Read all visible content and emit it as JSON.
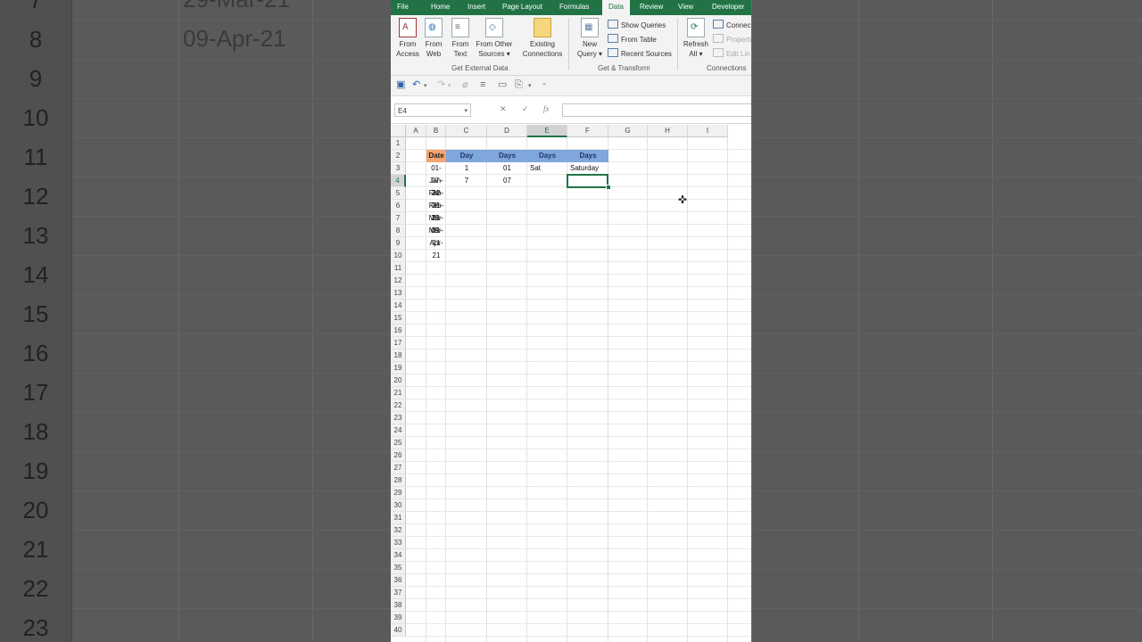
{
  "ribbon": {
    "tabs": [
      "File",
      "Home",
      "Insert",
      "Page Layout",
      "Formulas",
      "Data",
      "Review",
      "View",
      "Developer"
    ],
    "active_tab": "Data",
    "get_external_data": {
      "label": "Get External Data",
      "buttons": [
        {
          "line1": "From",
          "line2": "Access"
        },
        {
          "line1": "From",
          "line2": "Web"
        },
        {
          "line1": "From",
          "line2": "Text"
        },
        {
          "line1": "From Other",
          "line2": "Sources ▾"
        },
        {
          "line1": "Existing",
          "line2": "Connections"
        }
      ]
    },
    "get_transform": {
      "label": "Get & Transform",
      "new_query": {
        "line1": "New",
        "line2": "Query ▾"
      },
      "show_queries": "Show Queries",
      "from_table": "From Table",
      "recent_sources": "Recent Sources"
    },
    "connections": {
      "label": "Connections",
      "refresh_all": {
        "line1": "Refresh",
        "line2": "All ▾"
      },
      "connections": "Connec",
      "properties": "Properti",
      "edit_links": "Edit Lin"
    }
  },
  "formula_bar": {
    "name_box": "E4",
    "formula": ""
  },
  "columns": [
    "A",
    "B",
    "C",
    "D",
    "E",
    "F",
    "G",
    "H",
    "I"
  ],
  "selected_column": "E",
  "selected_row": "4",
  "rows": [
    "1",
    "2",
    "3",
    "4",
    "5",
    "6",
    "7",
    "8",
    "9",
    "10",
    "11",
    "12",
    "13",
    "14",
    "15",
    "16",
    "17",
    "18",
    "19",
    "20",
    "21",
    "22",
    "23",
    "24",
    "25",
    "26",
    "27",
    "28",
    "29",
    "30",
    "31",
    "32",
    "33",
    "34",
    "35",
    "36",
    "37",
    "38",
    "39",
    "40"
  ],
  "table": {
    "headers": [
      "Date",
      "Day",
      "Days",
      "Days",
      "Days"
    ],
    "body": [
      [
        "01-Jan-22",
        "1",
        "01",
        "Sat",
        "Saturday"
      ],
      [
        "07-Feb-21",
        "7",
        "07",
        "",
        ""
      ],
      [
        "24-Feb-21",
        "",
        "",
        "",
        ""
      ],
      [
        "08-Mar-21",
        "",
        "",
        "",
        ""
      ],
      [
        "29-Mar-21",
        "",
        "",
        "",
        ""
      ],
      [
        "09-Apr-21",
        "",
        "",
        "",
        ""
      ]
    ]
  },
  "background": {
    "rows": [
      "7",
      "8",
      "9",
      "10",
      "11",
      "12",
      "13",
      "14",
      "15",
      "16",
      "17",
      "18",
      "19",
      "20",
      "21",
      "22",
      "23"
    ],
    "ghost_text": [
      "29-Mar-21",
      "09-Apr-21"
    ]
  }
}
